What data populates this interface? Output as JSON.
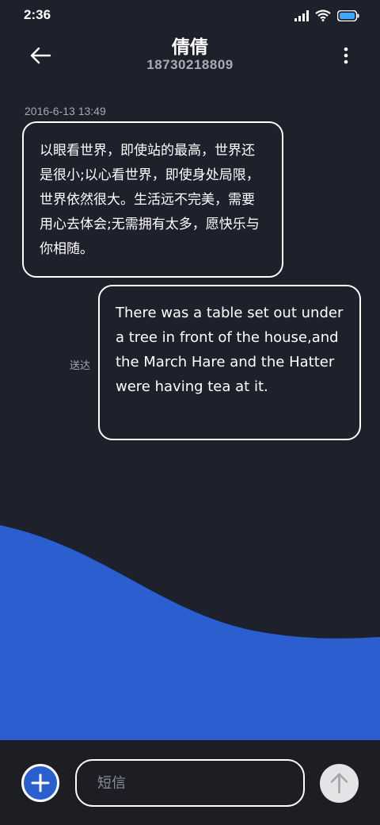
{
  "status_bar": {
    "time": "2:36",
    "icons": [
      "signal-icon",
      "wifi-icon",
      "battery-icon"
    ]
  },
  "header": {
    "contact_name": "倩倩",
    "phone_number": "18730218809",
    "back_icon": "arrow-left-icon",
    "more_icon": "more-vert-icon"
  },
  "conversation": {
    "timestamp": "2016-6-13 13:49",
    "messages": [
      {
        "direction": "incoming",
        "text": "以眼看世界，即使站的最高，世界还是很小;以心看世界，即使身处局限，世界依然很大。生活远不完美，需要用心去体会;无需拥有太多，愿快乐与你相随。"
      },
      {
        "direction": "outgoing",
        "text": "There was a table set out under a tree in front of the house,and the March Hare and the Hatter were having tea at it.",
        "status": "送达"
      }
    ]
  },
  "composer": {
    "placeholder": "短信",
    "value": "",
    "add_icon": "plus-icon",
    "send_icon": "arrow-up-icon"
  },
  "colors": {
    "background": "#1e212b",
    "accent": "#2b5fcf",
    "bubble_border": "#ffffff",
    "secondary_text": "#a6a9b0",
    "send_button": "#e4e4e6"
  }
}
